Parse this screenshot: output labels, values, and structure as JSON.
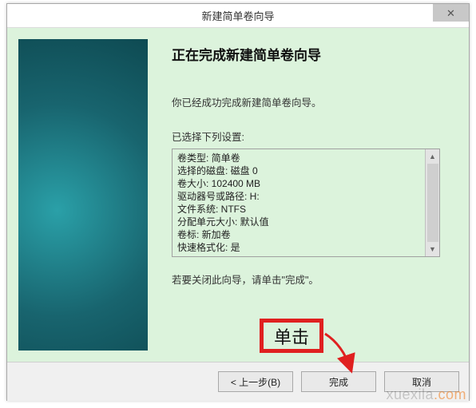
{
  "titlebar": {
    "title": "新建简单卷向导",
    "close": "✕"
  },
  "page": {
    "title": "正在完成新建简单卷向导",
    "intro": "你已经成功完成新建简单卷向导。",
    "summary_label": "已选择下列设置:",
    "close_hint": "若要关闭此向导，请单击\"完成\"。"
  },
  "summary": {
    "lines": [
      "卷类型: 简单卷",
      "选择的磁盘: 磁盘 0",
      "卷大小: 102400 MB",
      "驱动器号或路径: H:",
      "文件系统: NTFS",
      "分配单元大小: 默认值",
      "卷标: 新加卷",
      "快速格式化: 是"
    ]
  },
  "buttons": {
    "back": "< 上一步(B)",
    "finish": "完成",
    "cancel": "取消"
  },
  "callout": {
    "label": "单击"
  },
  "watermark": {
    "text_plain": "xuexila",
    "text_accent": ".com"
  }
}
